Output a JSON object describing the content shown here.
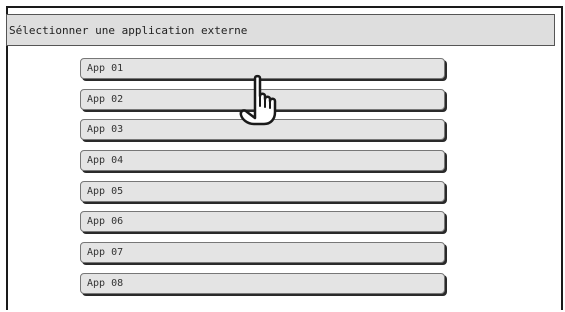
{
  "dialog": {
    "title": "Sélectionner une application externe"
  },
  "apps": [
    {
      "label": "App 01"
    },
    {
      "label": "App 02"
    },
    {
      "label": "App 03"
    },
    {
      "label": "App 04"
    },
    {
      "label": "App 05"
    },
    {
      "label": "App 06"
    },
    {
      "label": "App 07"
    },
    {
      "label": "App 08"
    }
  ],
  "pointer": {
    "icon": "pointing-hand-icon"
  }
}
